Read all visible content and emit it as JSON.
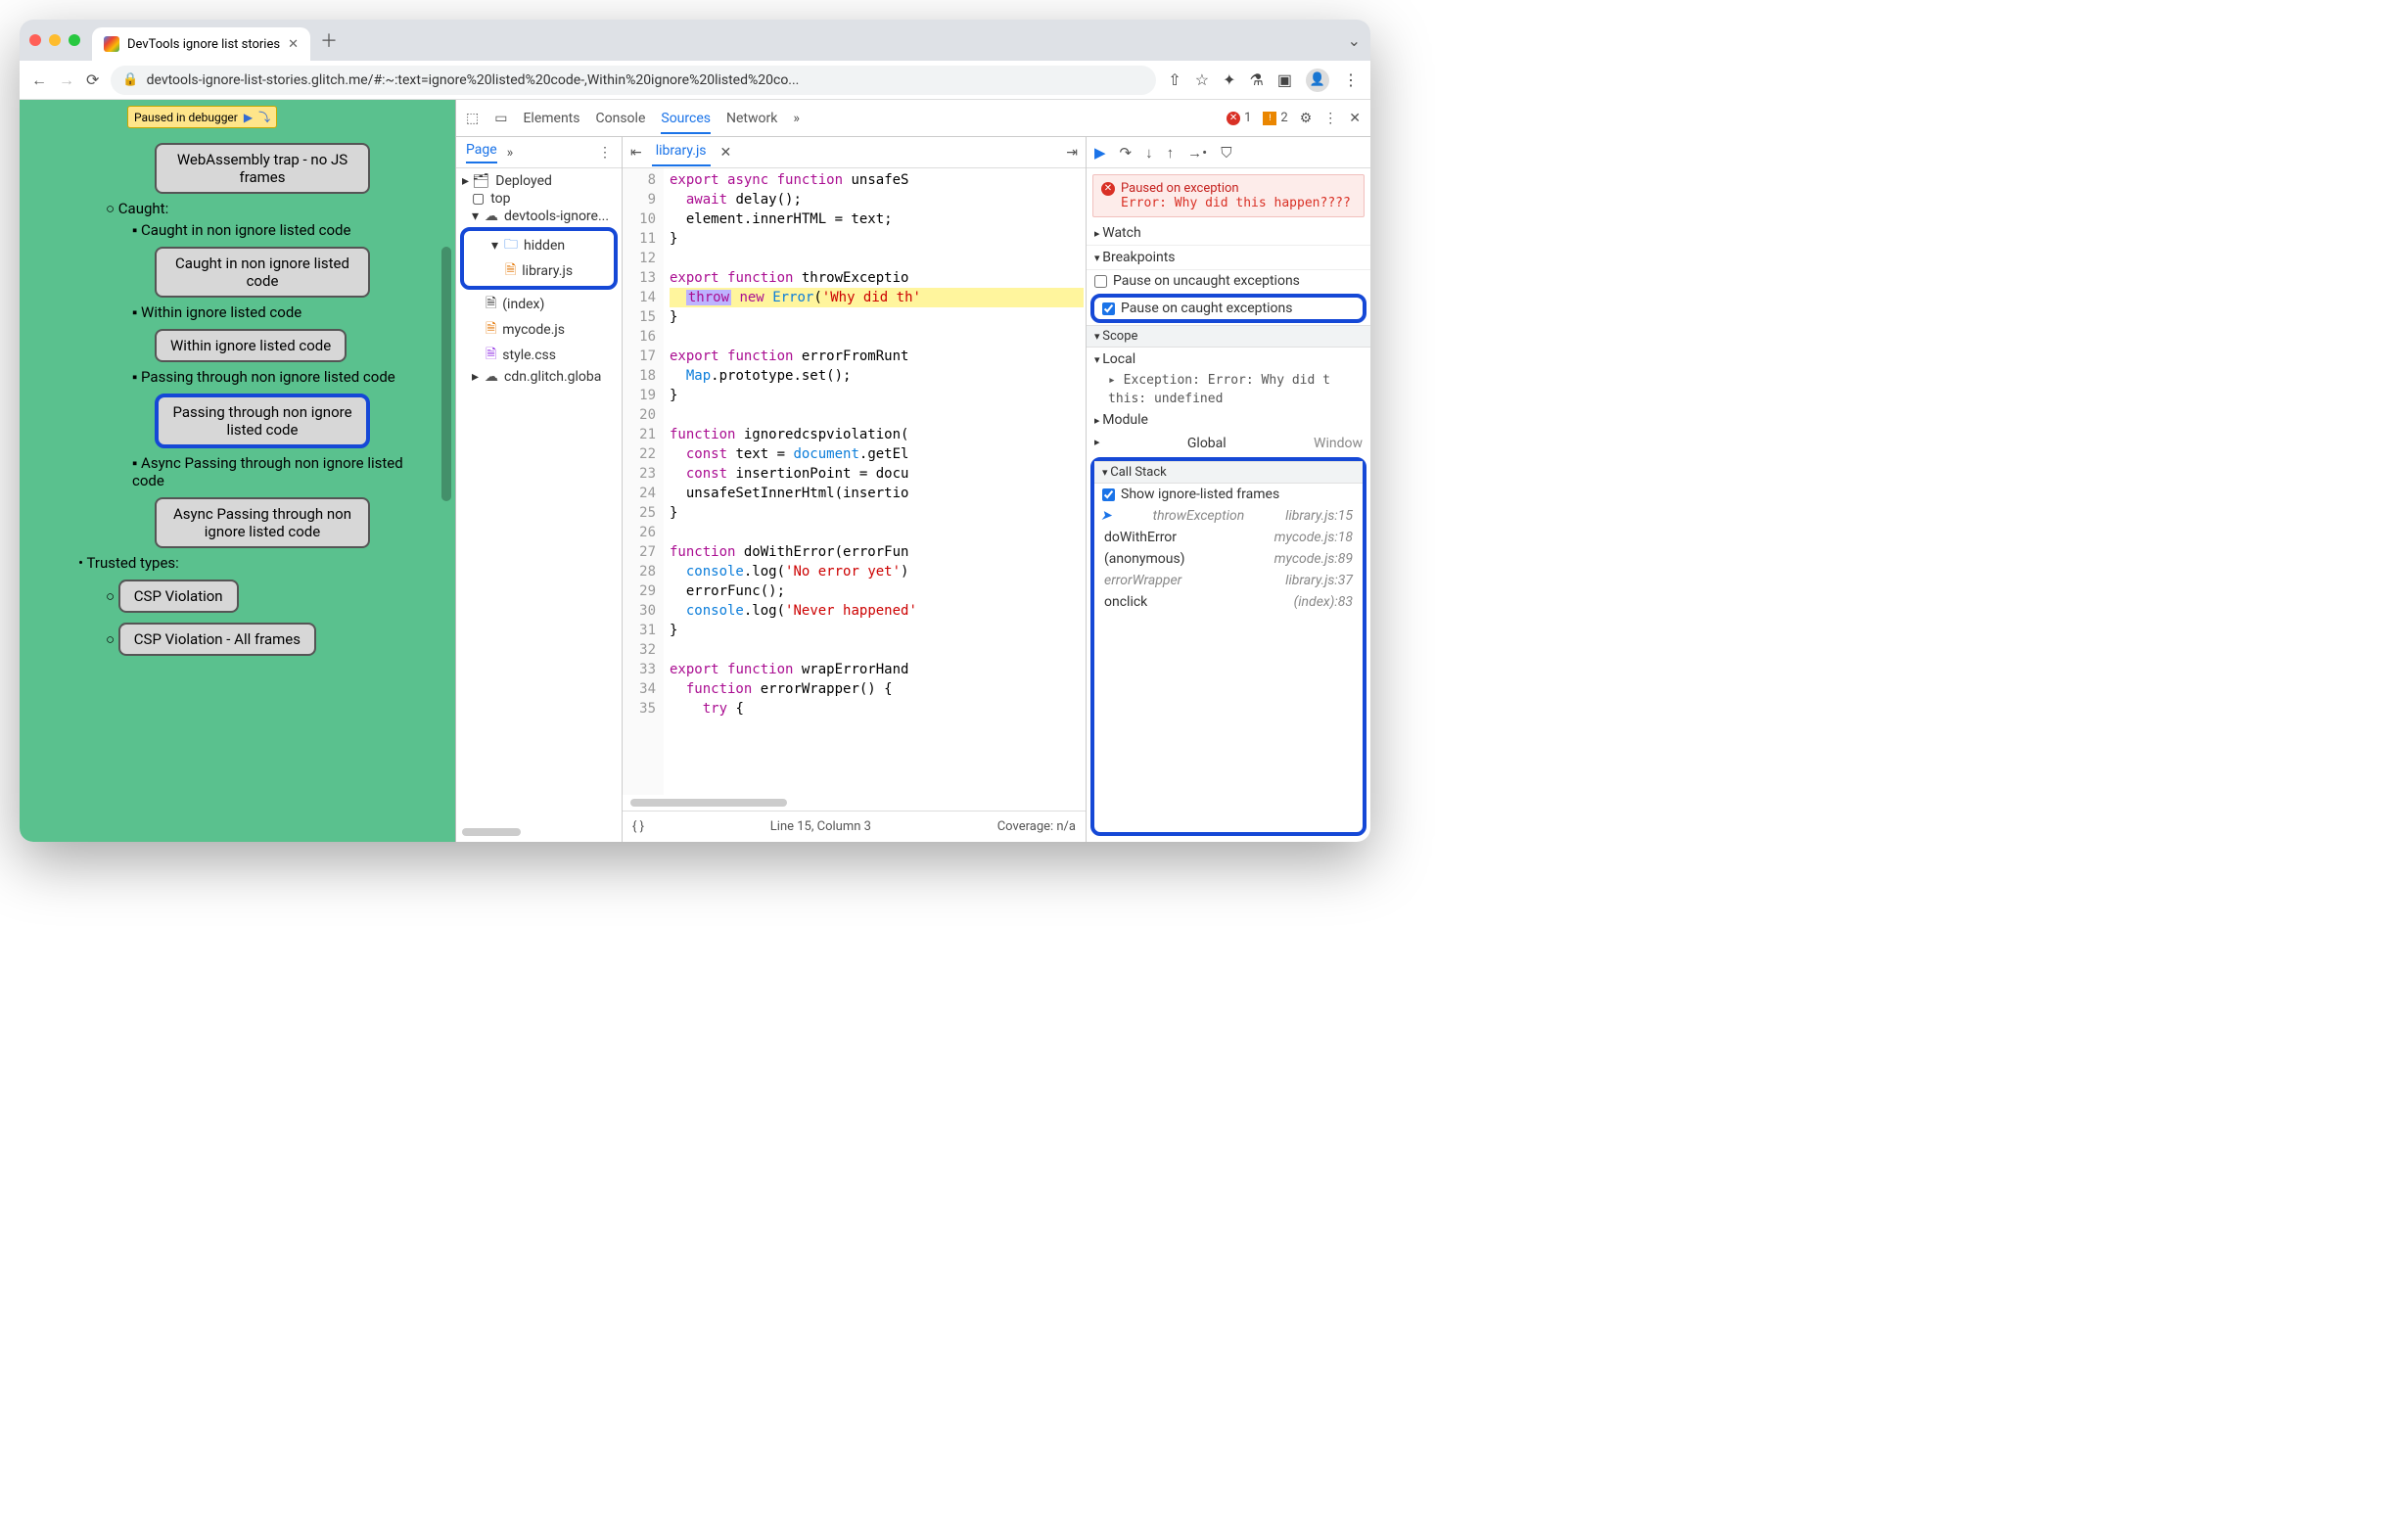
{
  "browser": {
    "tab_title": "DevTools ignore list stories",
    "url": "devtools-ignore-list-stories.glitch.me/#:~:text=ignore%20listed%20code-,Within%20ignore%20listed%20co..."
  },
  "paused_chip": "Paused in debugger",
  "demo_page": {
    "top_button": "WebAssembly trap - no JS frames",
    "caught_header": "Caught:",
    "items": [
      {
        "label": "Caught in non ignore listed code",
        "button": "Caught in non ignore listed code"
      },
      {
        "label": "Within ignore listed code",
        "button": "Within ignore listed code"
      },
      {
        "label": "Passing through non ignore listed code",
        "button": "Passing through non ignore listed code",
        "highlight": true
      },
      {
        "label": "Async Passing through non ignore listed code",
        "button": "Async Passing through non ignore listed code"
      }
    ],
    "trusted_header": "Trusted types:",
    "trusted_buttons": [
      "CSP Violation",
      "CSP Violation - All frames"
    ]
  },
  "devtools": {
    "panels": [
      "Elements",
      "Console",
      "Sources",
      "Network"
    ],
    "active_panel": "Sources",
    "errors": 1,
    "warnings": 2,
    "nav": {
      "subpanel": "Page",
      "tree": {
        "deployed": "Deployed",
        "top": "top",
        "domain": "devtools-ignore...",
        "hidden_folder": "hidden",
        "hidden_file": "library.js",
        "index": "(index)",
        "mycode": "mycode.js",
        "style": "style.css",
        "cdn": "cdn.glitch.globa"
      }
    },
    "editor": {
      "filename": "library.js",
      "first_line": 8,
      "lines": [
        "export async function unsafeS",
        "  await delay();",
        "  element.innerHTML = text;",
        "}",
        "",
        "export function throwExceptio",
        "  throw new Error('Why did th",
        "}",
        "",
        "export function errorFromRunt",
        "  Map.prototype.set();",
        "}",
        "",
        "function ignoredcspviolation(",
        "  const text = document.getEl",
        "  const insertionPoint = docu",
        "  unsafeSetInnerHtml(insertio",
        "}",
        "",
        "function doWithError(errorFun",
        "  console.log('No error yet')",
        "  errorFunc();",
        "  console.log('Never happened",
        "}",
        "",
        "export function wrapErrorHand",
        "  function errorWrapper() {",
        "    try {"
      ],
      "highlight_line_index": 7,
      "status_line": "Line 15, Column 3",
      "coverage": "Coverage: n/a"
    },
    "debug": {
      "paused_title": "Paused on exception",
      "paused_msg": "Error: Why did this happen????",
      "watch": "Watch",
      "breakpoints_header": "Breakpoints",
      "bp_uncaught": "Pause on uncaught exceptions",
      "bp_caught": "Pause on caught exceptions",
      "scope_header": "Scope",
      "scope_local": "Local",
      "scope_exc": "Exception: Error: Why did t",
      "scope_this": "this: undefined",
      "scope_module": "Module",
      "scope_global": "Global",
      "scope_global_val": "Window",
      "callstack_header": "Call Stack",
      "callstack_show": "Show ignore-listed frames",
      "frames": [
        {
          "name": "throwException",
          "loc": "library.js:15",
          "ital": true,
          "current": true
        },
        {
          "name": "doWithError",
          "loc": "mycode.js:18"
        },
        {
          "name": "(anonymous)",
          "loc": "mycode.js:89"
        },
        {
          "name": "errorWrapper",
          "loc": "library.js:37",
          "ital": true
        },
        {
          "name": "onclick",
          "loc": "(index):83"
        }
      ]
    }
  }
}
